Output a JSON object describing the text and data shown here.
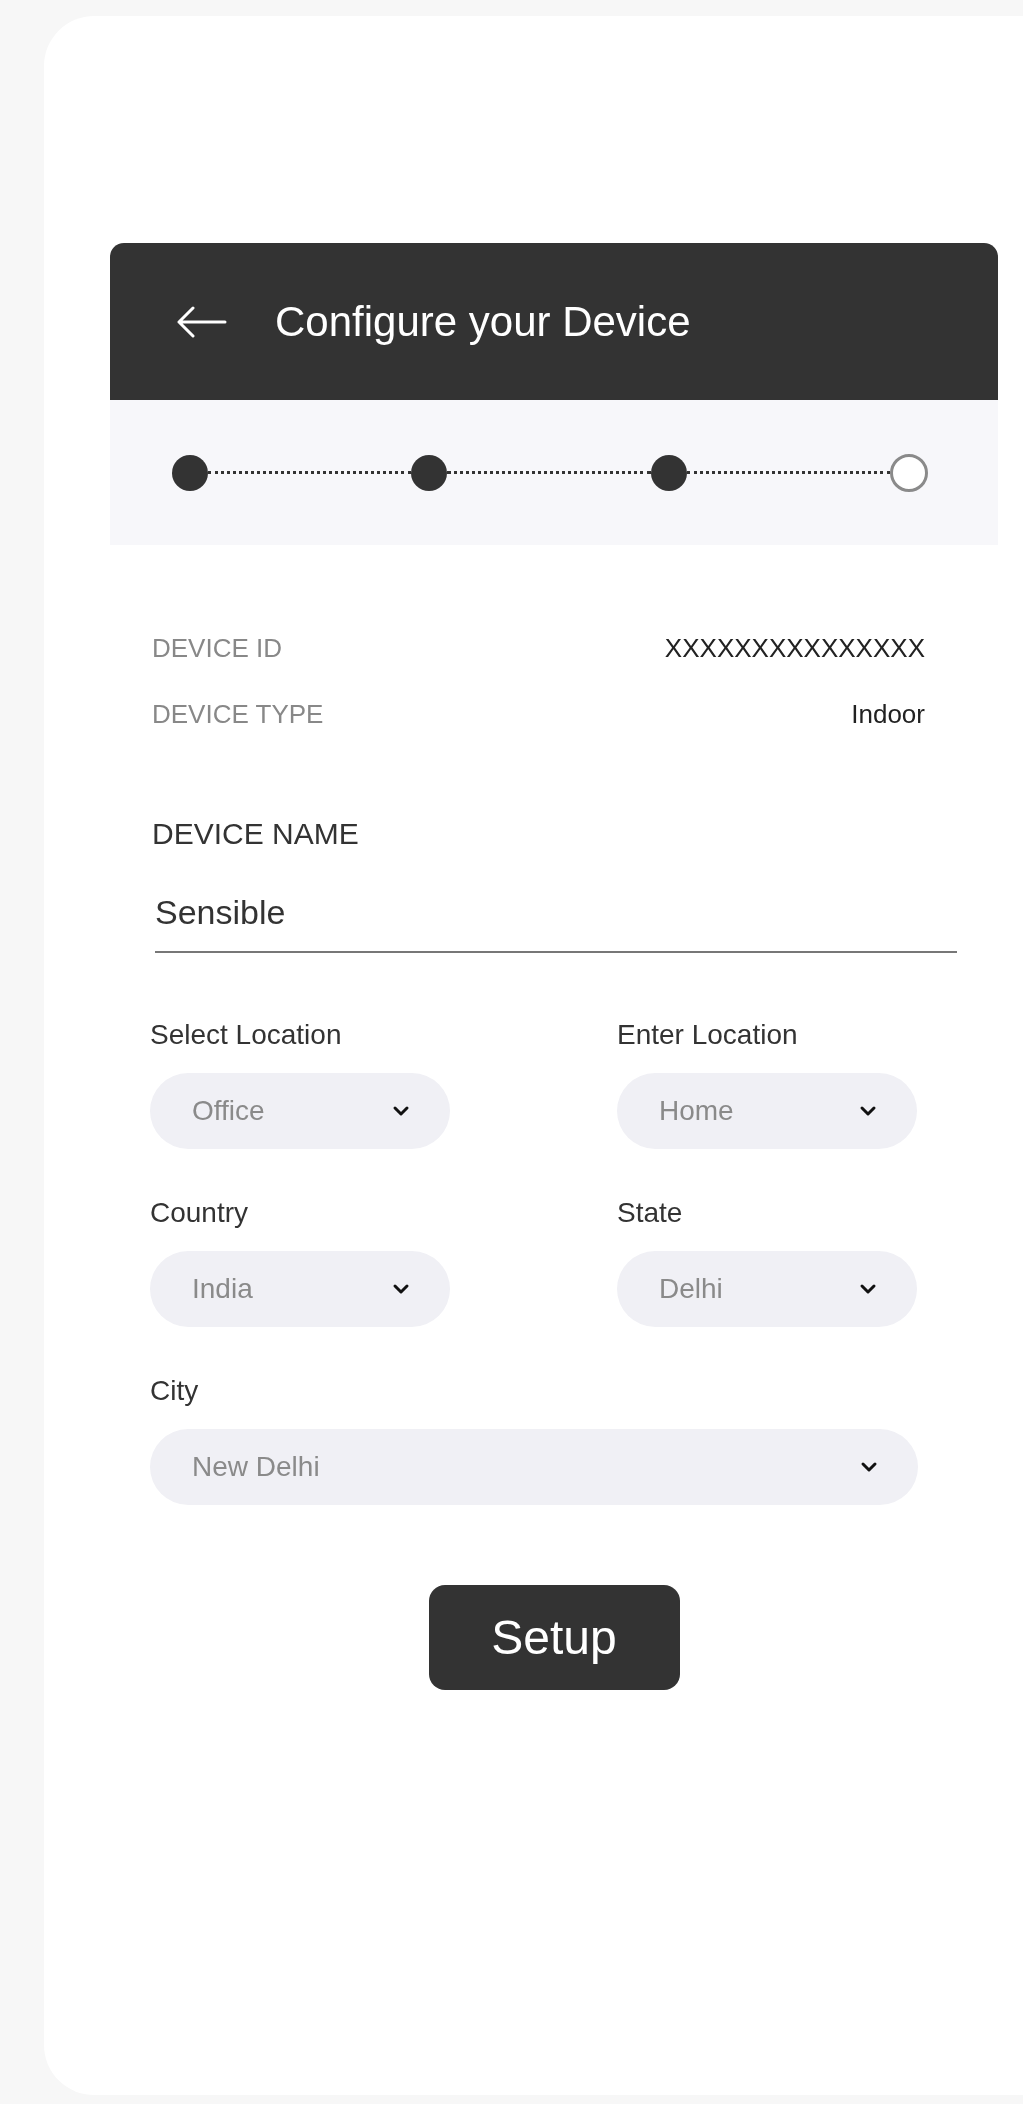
{
  "header": {
    "title": "Configure your Device"
  },
  "steps": [
    {
      "completed": true
    },
    {
      "completed": true
    },
    {
      "completed": true
    },
    {
      "completed": false
    }
  ],
  "info": [
    {
      "label": "DEVICE ID",
      "value": "XXXXXXXXXXXXXXX"
    },
    {
      "label": "DEVICE TYPE",
      "value": "Indoor"
    }
  ],
  "device_name": {
    "label": "DEVICE NAME",
    "value": "Sensible"
  },
  "dropdown_rows": [
    [
      {
        "label": "Select Location",
        "value": "Office"
      },
      {
        "label": "Enter Location",
        "value": "Home"
      }
    ],
    [
      {
        "label": "Country",
        "value": "India"
      },
      {
        "label": "State",
        "value": "Delhi"
      }
    ],
    [
      {
        "label": "City",
        "value": "New Delhi"
      }
    ]
  ],
  "button": "Setup"
}
